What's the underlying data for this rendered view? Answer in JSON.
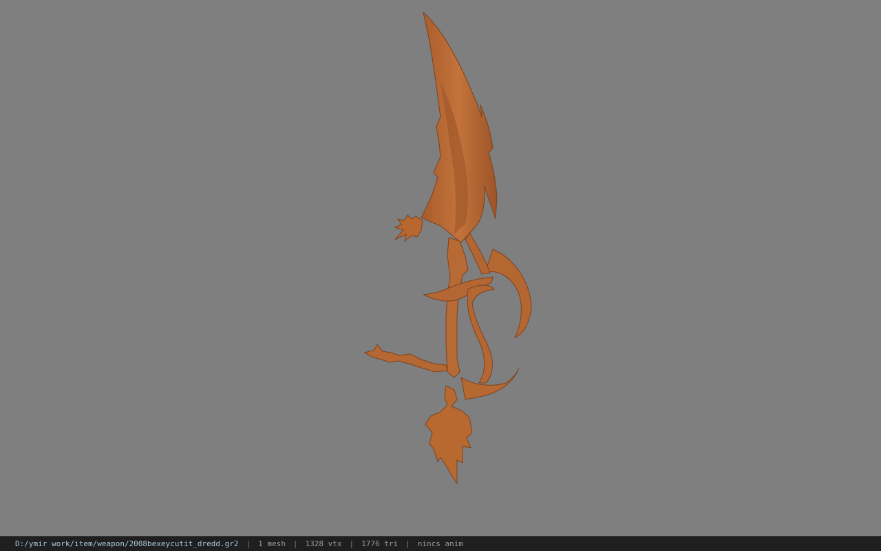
{
  "viewer": {
    "background_color": "#7f7f7f",
    "model": {
      "color": "#b86a35",
      "shadow_color": "#8a4a22",
      "highlight_color": "#cf7f46"
    }
  },
  "status_bar": {
    "file_path": "D:/ymir work/item/weapon/2008bexeycutit_dredd.gr2",
    "mesh_count": "1 mesh",
    "vertex_count": "1328 vtx",
    "triangle_count": "1776 tri",
    "anim_info": "nincs anim",
    "separator": "|"
  }
}
